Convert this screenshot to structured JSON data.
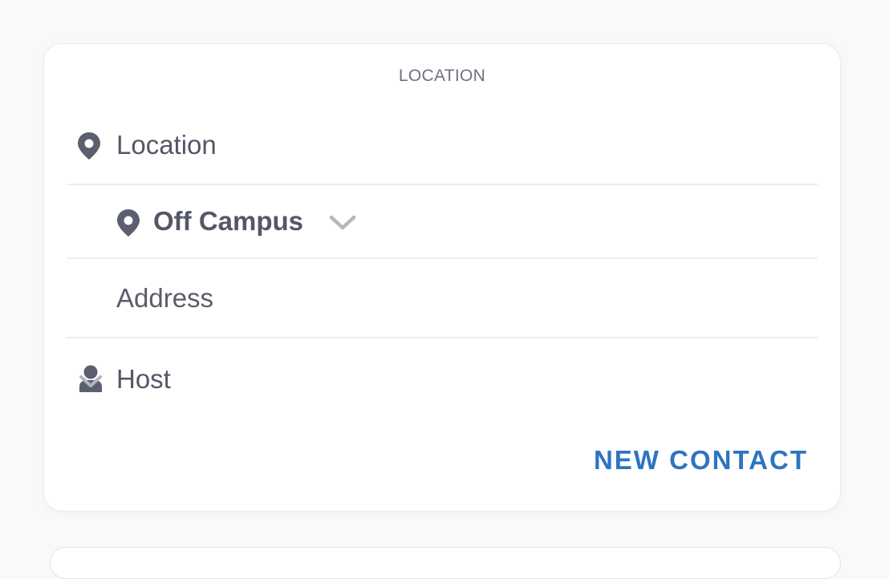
{
  "section": {
    "title": "LOCATION"
  },
  "location": {
    "label": "Location",
    "icon": "map-pin-icon"
  },
  "campus": {
    "value": "Off Campus",
    "icon": "map-pin-icon",
    "chevron": "chevron-down-icon"
  },
  "address": {
    "placeholder": "Address",
    "value": ""
  },
  "host": {
    "label": "Host",
    "icon": "person-icon",
    "chevron": "chevron-down-icon"
  },
  "actions": {
    "new_contact": "NEW CONTACT"
  },
  "colors": {
    "accent": "#2e74c1",
    "text": "#545766",
    "muted": "#6e7181",
    "chevron": "#b5b6bf",
    "divider": "#eeeef0"
  }
}
